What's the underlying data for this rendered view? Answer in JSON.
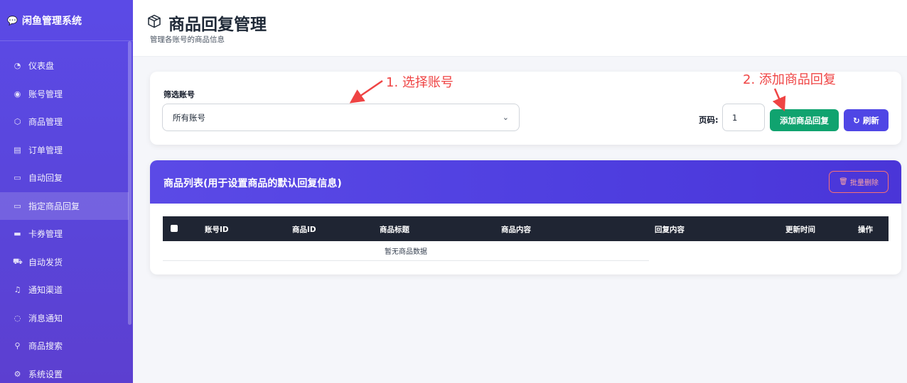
{
  "sidebar": {
    "brand": "闲鱼管理系统",
    "items": [
      {
        "label": "仪表盘",
        "icon": "gauge-icon"
      },
      {
        "label": "账号管理",
        "icon": "user-circle-icon"
      },
      {
        "label": "商品管理",
        "icon": "box-icon"
      },
      {
        "label": "订单管理",
        "icon": "receipt-icon"
      },
      {
        "label": "自动回复",
        "icon": "chat-icon"
      },
      {
        "label": "指定商品回复",
        "icon": "chat-icon",
        "active": true
      },
      {
        "label": "卡券管理",
        "icon": "card-icon"
      },
      {
        "label": "自动发货",
        "icon": "truck-icon"
      },
      {
        "label": "通知渠道",
        "icon": "bell-icon"
      },
      {
        "label": "消息通知",
        "icon": "message-icon"
      },
      {
        "label": "商品搜索",
        "icon": "search-icon"
      },
      {
        "label": "系统设置",
        "icon": "gear-icon"
      }
    ]
  },
  "header": {
    "title": "商品回复管理",
    "subtitle": "管理各账号的商品信息"
  },
  "filter": {
    "label": "筛选账号",
    "select_value": "所有账号",
    "page_label": "页码:",
    "page_value": "1",
    "add_button": "添加商品回复",
    "refresh_button": "刷新"
  },
  "annotations": {
    "step1": "1. 选择账号",
    "step2": "2. 添加商品回复"
  },
  "list": {
    "title": "商品列表(用于设置商品的默认回复信息)",
    "batch_delete": "批量删除",
    "columns": [
      "账号ID",
      "商品ID",
      "商品标题",
      "商品内容",
      "回复内容",
      "更新时间",
      "操作"
    ],
    "empty_text": "暂无商品数据"
  },
  "colors": {
    "sidebar": "#5b4ae6",
    "primary": "#4f46e5",
    "success": "#10a36f",
    "danger": "#ef4444",
    "table_header": "#1f2533"
  }
}
